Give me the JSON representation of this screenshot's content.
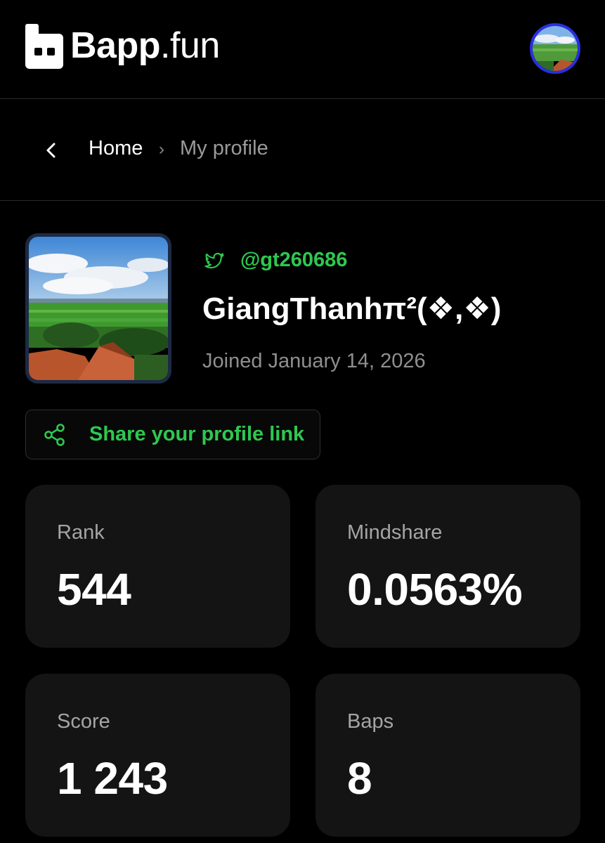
{
  "header": {
    "brand_bold": "Bapp",
    "brand_light": ".fun",
    "logo_icon": "bapp-logo-icon",
    "avatar_icon": "user-avatar"
  },
  "breadcrumb": {
    "back_icon": "chevron-left-icon",
    "home": "Home",
    "separator": "›",
    "current": "My profile"
  },
  "profile": {
    "twitter_icon": "twitter-bird-icon",
    "handle": "@gt260686",
    "display_name": "GiangThanhπ²(❖,❖)",
    "joined": "Joined January 14, 2026"
  },
  "share": {
    "icon": "share-icon",
    "label": "Share your profile link"
  },
  "stats": {
    "rank": {
      "label": "Rank",
      "value": "544"
    },
    "mindshare": {
      "label": "Mindshare",
      "value": "0.0563%"
    },
    "score": {
      "label": "Score",
      "value": "1 243"
    },
    "baps": {
      "label": "Baps",
      "value": "8"
    }
  },
  "colors": {
    "background": "#000000",
    "accent_green": "#2ec84f",
    "card_bg": "#141414",
    "muted_text": "#8f8f8f",
    "avatar_ring": "#2b2ee0"
  }
}
